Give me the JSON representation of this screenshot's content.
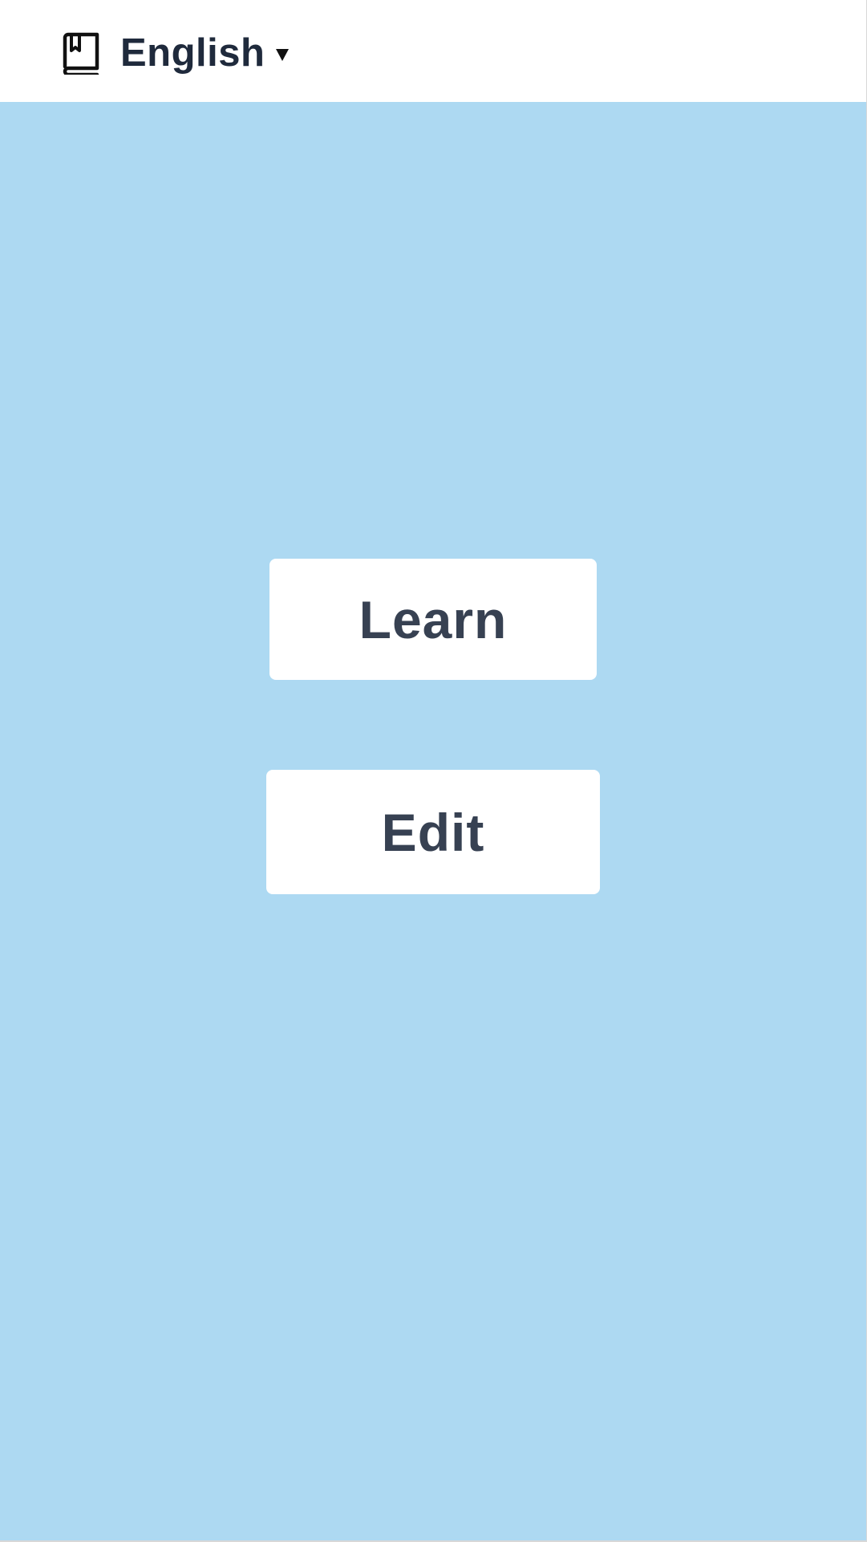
{
  "header": {
    "language_selector": {
      "icon": "book-icon",
      "selected_value": "English",
      "caret_icon": "caret-down-icon"
    }
  },
  "main": {
    "background_color": "#add9f2",
    "buttons": {
      "learn_label": "Learn",
      "edit_label": "Edit"
    }
  },
  "colors": {
    "text_dark": "#1f2a3c",
    "button_text": "#374152",
    "button_bg": "#ffffff"
  }
}
